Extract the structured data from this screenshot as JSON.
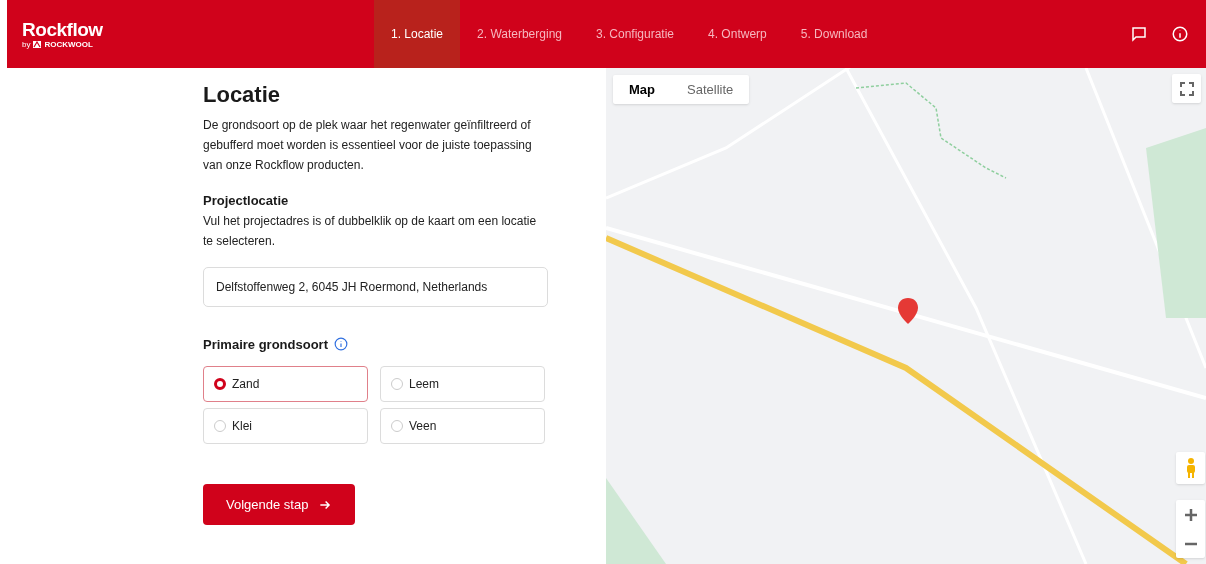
{
  "header": {
    "logo": "Rockflow",
    "logo_by": "by",
    "logo_brand": "ROCKWOOL",
    "steps": [
      {
        "label": "1. Locatie",
        "selected": true
      },
      {
        "label": "2. Waterberging",
        "selected": false
      },
      {
        "label": "3. Configuratie",
        "selected": false
      },
      {
        "label": "4. Ontwerp",
        "selected": false
      },
      {
        "label": "5. Download",
        "selected": false
      }
    ]
  },
  "form": {
    "title": "Locatie",
    "intro": "De grondsoort op de plek waar het regenwater geïnfiltreerd of gebufferd moet worden is essentieel voor de juiste toepassing van onze Rockflow producten.",
    "section_title": "Projectlocatie",
    "instruction": "Vul het projectadres is of dubbelklik op de kaart om een locatie te selecteren.",
    "address": "Delfstoffenweg 2, 6045 JH Roermond, Netherlands",
    "soil_label": "Primaire grondsoort",
    "soil_options": [
      {
        "label": "Zand",
        "selected": true
      },
      {
        "label": "Leem",
        "selected": false
      },
      {
        "label": "Klei",
        "selected": false
      },
      {
        "label": "Veen",
        "selected": false
      }
    ],
    "next_button": "Volgende stap"
  },
  "map": {
    "map_types": [
      {
        "label": "Map",
        "selected": true
      },
      {
        "label": "Satellite",
        "selected": false
      }
    ]
  }
}
